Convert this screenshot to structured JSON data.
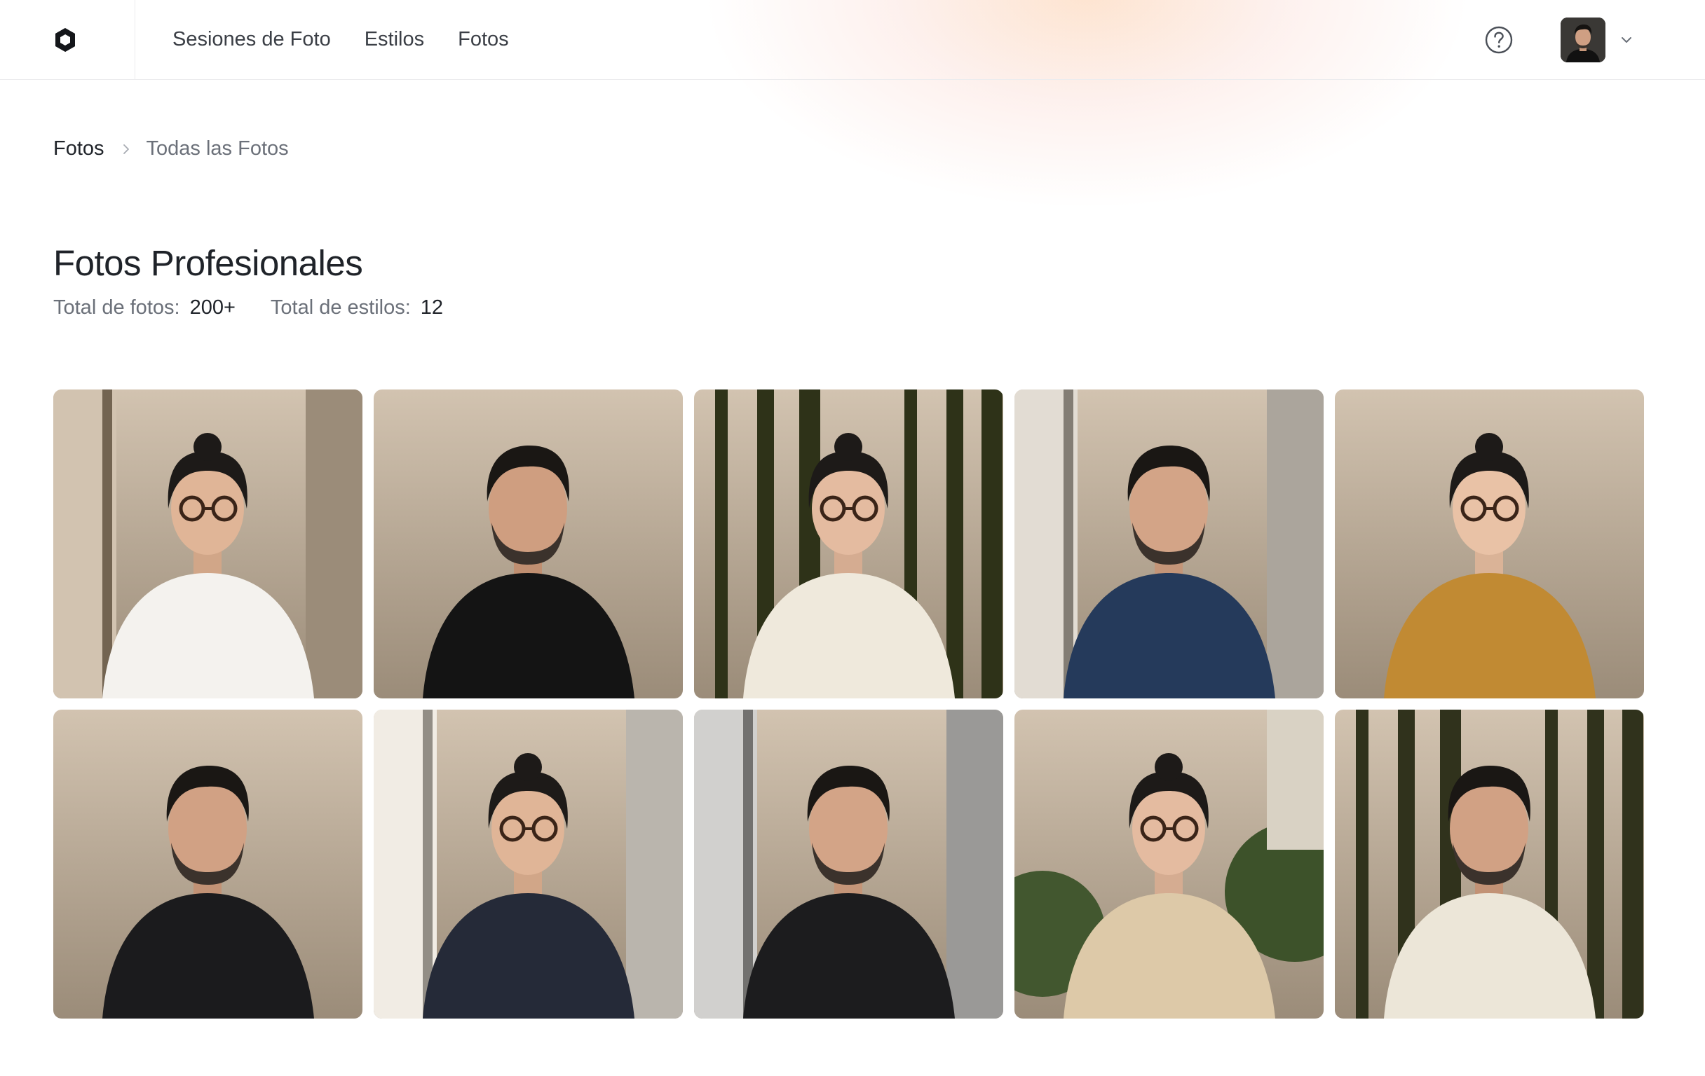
{
  "nav": {
    "logo_icon": "logo-icon",
    "links": [
      "Sesiones de Foto",
      "Estilos",
      "Fotos"
    ],
    "help_icon": "help-circle-icon",
    "avatar_icon": "user-avatar",
    "menu_icon": "chevron-down-icon"
  },
  "breadcrumb": {
    "root": "Fotos",
    "current": "Todas las Fotos"
  },
  "page": {
    "title": "Fotos Profesionales",
    "photos_label": "Total de fotos:",
    "photos_value": "200+",
    "styles_label": "Total de estilos:",
    "styles_value": "12"
  },
  "photos": [
    {
      "subject": "woman",
      "setting": "street",
      "bg": "#b9aa97",
      "outfit": "#f4f2ee",
      "hair": "#1d1a18",
      "skin": "#e0b597",
      "glasses": true
    },
    {
      "subject": "man",
      "setting": "studio",
      "bg": "#45474a",
      "outfit": "#141414",
      "hair": "#1a1714",
      "skin": "#cf9e80",
      "glasses": false
    },
    {
      "subject": "woman",
      "setting": "forest",
      "bg": "#5b5f45",
      "outfit": "#efe9dc",
      "hair": "#1d1a18",
      "skin": "#e4bba0",
      "glasses": true
    },
    {
      "subject": "man",
      "setting": "office",
      "bg": "#c9c3ba",
      "outfit": "#253a5b",
      "hair": "#1a1714",
      "skin": "#d3a487",
      "glasses": false
    },
    {
      "subject": "woman",
      "setting": "studio",
      "bg": "#e3d9cc",
      "outfit": "#c18a33",
      "hair": "#1d1a18",
      "skin": "#e9c2a6",
      "glasses": true
    },
    {
      "subject": "man",
      "setting": "studio",
      "bg": "#3f4042",
      "outfit": "#1b1b1d",
      "hair": "#1a1714",
      "skin": "#d1a184",
      "glasses": false
    },
    {
      "subject": "woman",
      "setting": "window",
      "bg": "#d8d3cb",
      "outfit": "#252a38",
      "hair": "#1d1a18",
      "skin": "#e0b597",
      "glasses": true
    },
    {
      "subject": "man",
      "setting": "window",
      "bg": "#b8b7b5",
      "outfit": "#1c1c1e",
      "hair": "#1a1714",
      "skin": "#d3a487",
      "glasses": false
    },
    {
      "subject": "woman",
      "setting": "garden",
      "bg": "#566b43",
      "outfit": "#ddc9a8",
      "hair": "#1d1a18",
      "skin": "#e4bba0",
      "glasses": true
    },
    {
      "subject": "man",
      "setting": "forest",
      "bg": "#5d5f49",
      "outfit": "#ece6d8",
      "hair": "#1a1714",
      "skin": "#d1a184",
      "glasses": false
    }
  ]
}
